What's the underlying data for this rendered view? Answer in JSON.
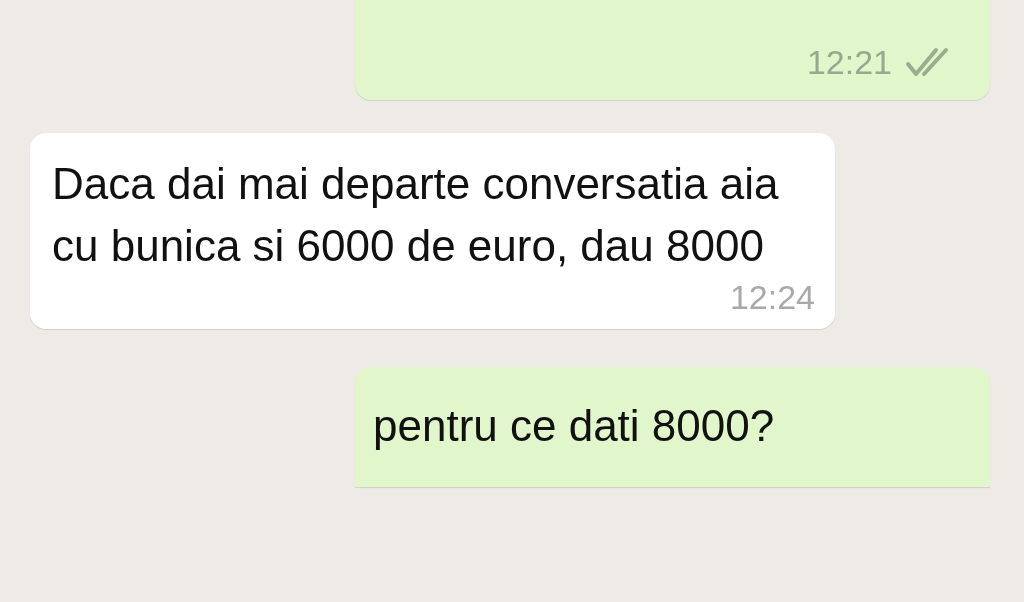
{
  "messages": [
    {
      "kind": "sent",
      "time": "12:21",
      "read": false
    },
    {
      "kind": "received",
      "text": "Daca dai mai departe conversatia aia cu bunica si 6000 de euro, dau 8000",
      "time": "12:24"
    },
    {
      "kind": "sent",
      "text": "pentru ce dati 8000?"
    }
  ]
}
